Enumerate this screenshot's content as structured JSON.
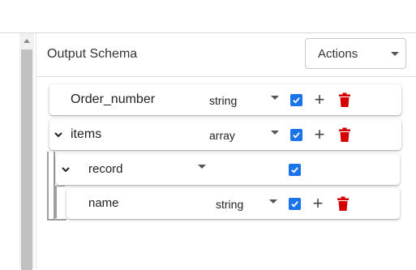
{
  "panel": {
    "title": "Output Schema",
    "actions": {
      "label": "Actions"
    }
  },
  "rows": [
    {
      "name": "Order_number",
      "type": "string",
      "checked": true,
      "expandable": false
    },
    {
      "name": "items",
      "type": "array",
      "checked": true,
      "expandable": true
    },
    {
      "name": "record",
      "type": "",
      "checked": true,
      "expandable": true
    },
    {
      "name": "name",
      "type": "string",
      "checked": true,
      "expandable": false
    }
  ],
  "colors": {
    "checkbox": "#1a73e8",
    "delete": "#d50000",
    "icon": "#444444"
  },
  "icons": {
    "add": "plus-icon",
    "delete": "trash-icon",
    "expand": "chevron-down-icon",
    "dropdown": "caret-down-icon",
    "checkbox": "check-icon",
    "scroll": "scroll-up-arrow"
  }
}
